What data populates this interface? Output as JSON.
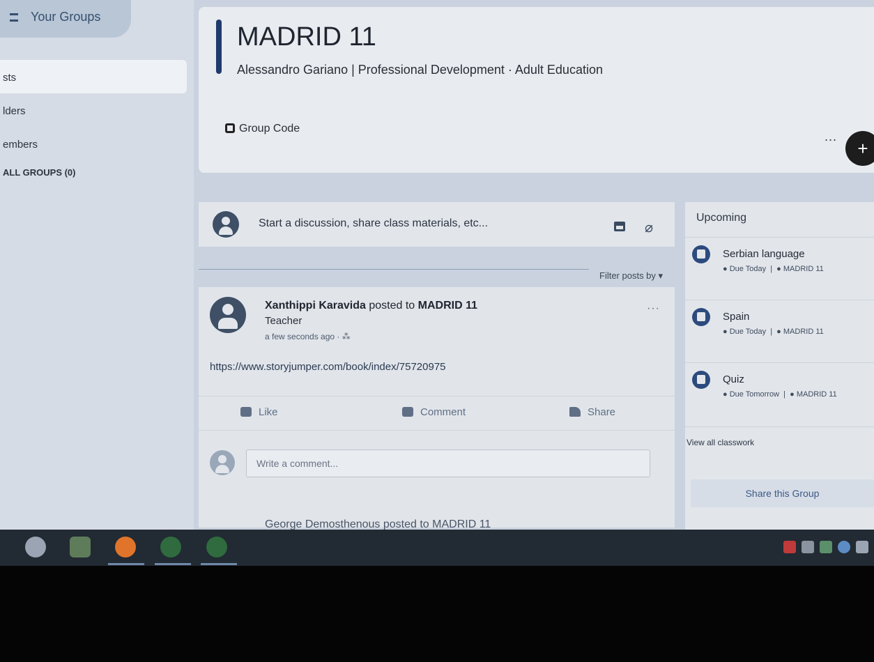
{
  "sidebar": {
    "your_groups": "Your Groups",
    "items": [
      {
        "label": "sts"
      },
      {
        "label": "lders"
      },
      {
        "label": "embers"
      }
    ],
    "small_groups": "ALL GROUPS (0)"
  },
  "header": {
    "title": "MADRID 11",
    "subtitle": "Alessandro Gariano | Professional Development · Adult Education",
    "group_code": "Group Code",
    "more": "...",
    "add": "+"
  },
  "composer": {
    "placeholder": "Start a discussion, share class materials, etc..."
  },
  "filter": {
    "label": "Filter posts by ▾"
  },
  "post": {
    "author": "Xanthippi Karavida",
    "posted_to_text": " posted to ",
    "group": "MADRID 11",
    "role": "Teacher",
    "time": "a few seconds ago · ⁂",
    "more": "···",
    "link": "https://www.storyjumper.com/book/index/75720975",
    "actions": {
      "like": "Like",
      "comment": "Comment",
      "share": "Share"
    },
    "comment_placeholder": "Write a comment..."
  },
  "next_post": {
    "text": "George Demosthenous posted to MADRID 11"
  },
  "upcoming": {
    "title": "Upcoming",
    "items": [
      {
        "name": "Serbian language",
        "due": "Due Today",
        "group": "MADRID 11"
      },
      {
        "name": "Spain",
        "due": "Due Today",
        "group": "MADRID 11"
      },
      {
        "name": "Quiz",
        "due": "Due Tomorrow",
        "group": "MADRID 11"
      }
    ],
    "view_all": "View all classwork",
    "share_group": "Share this Group"
  },
  "colors": {
    "accent": "#1f3a6d",
    "taskbar": "#222a33",
    "page_bg": "#c9d2de"
  }
}
